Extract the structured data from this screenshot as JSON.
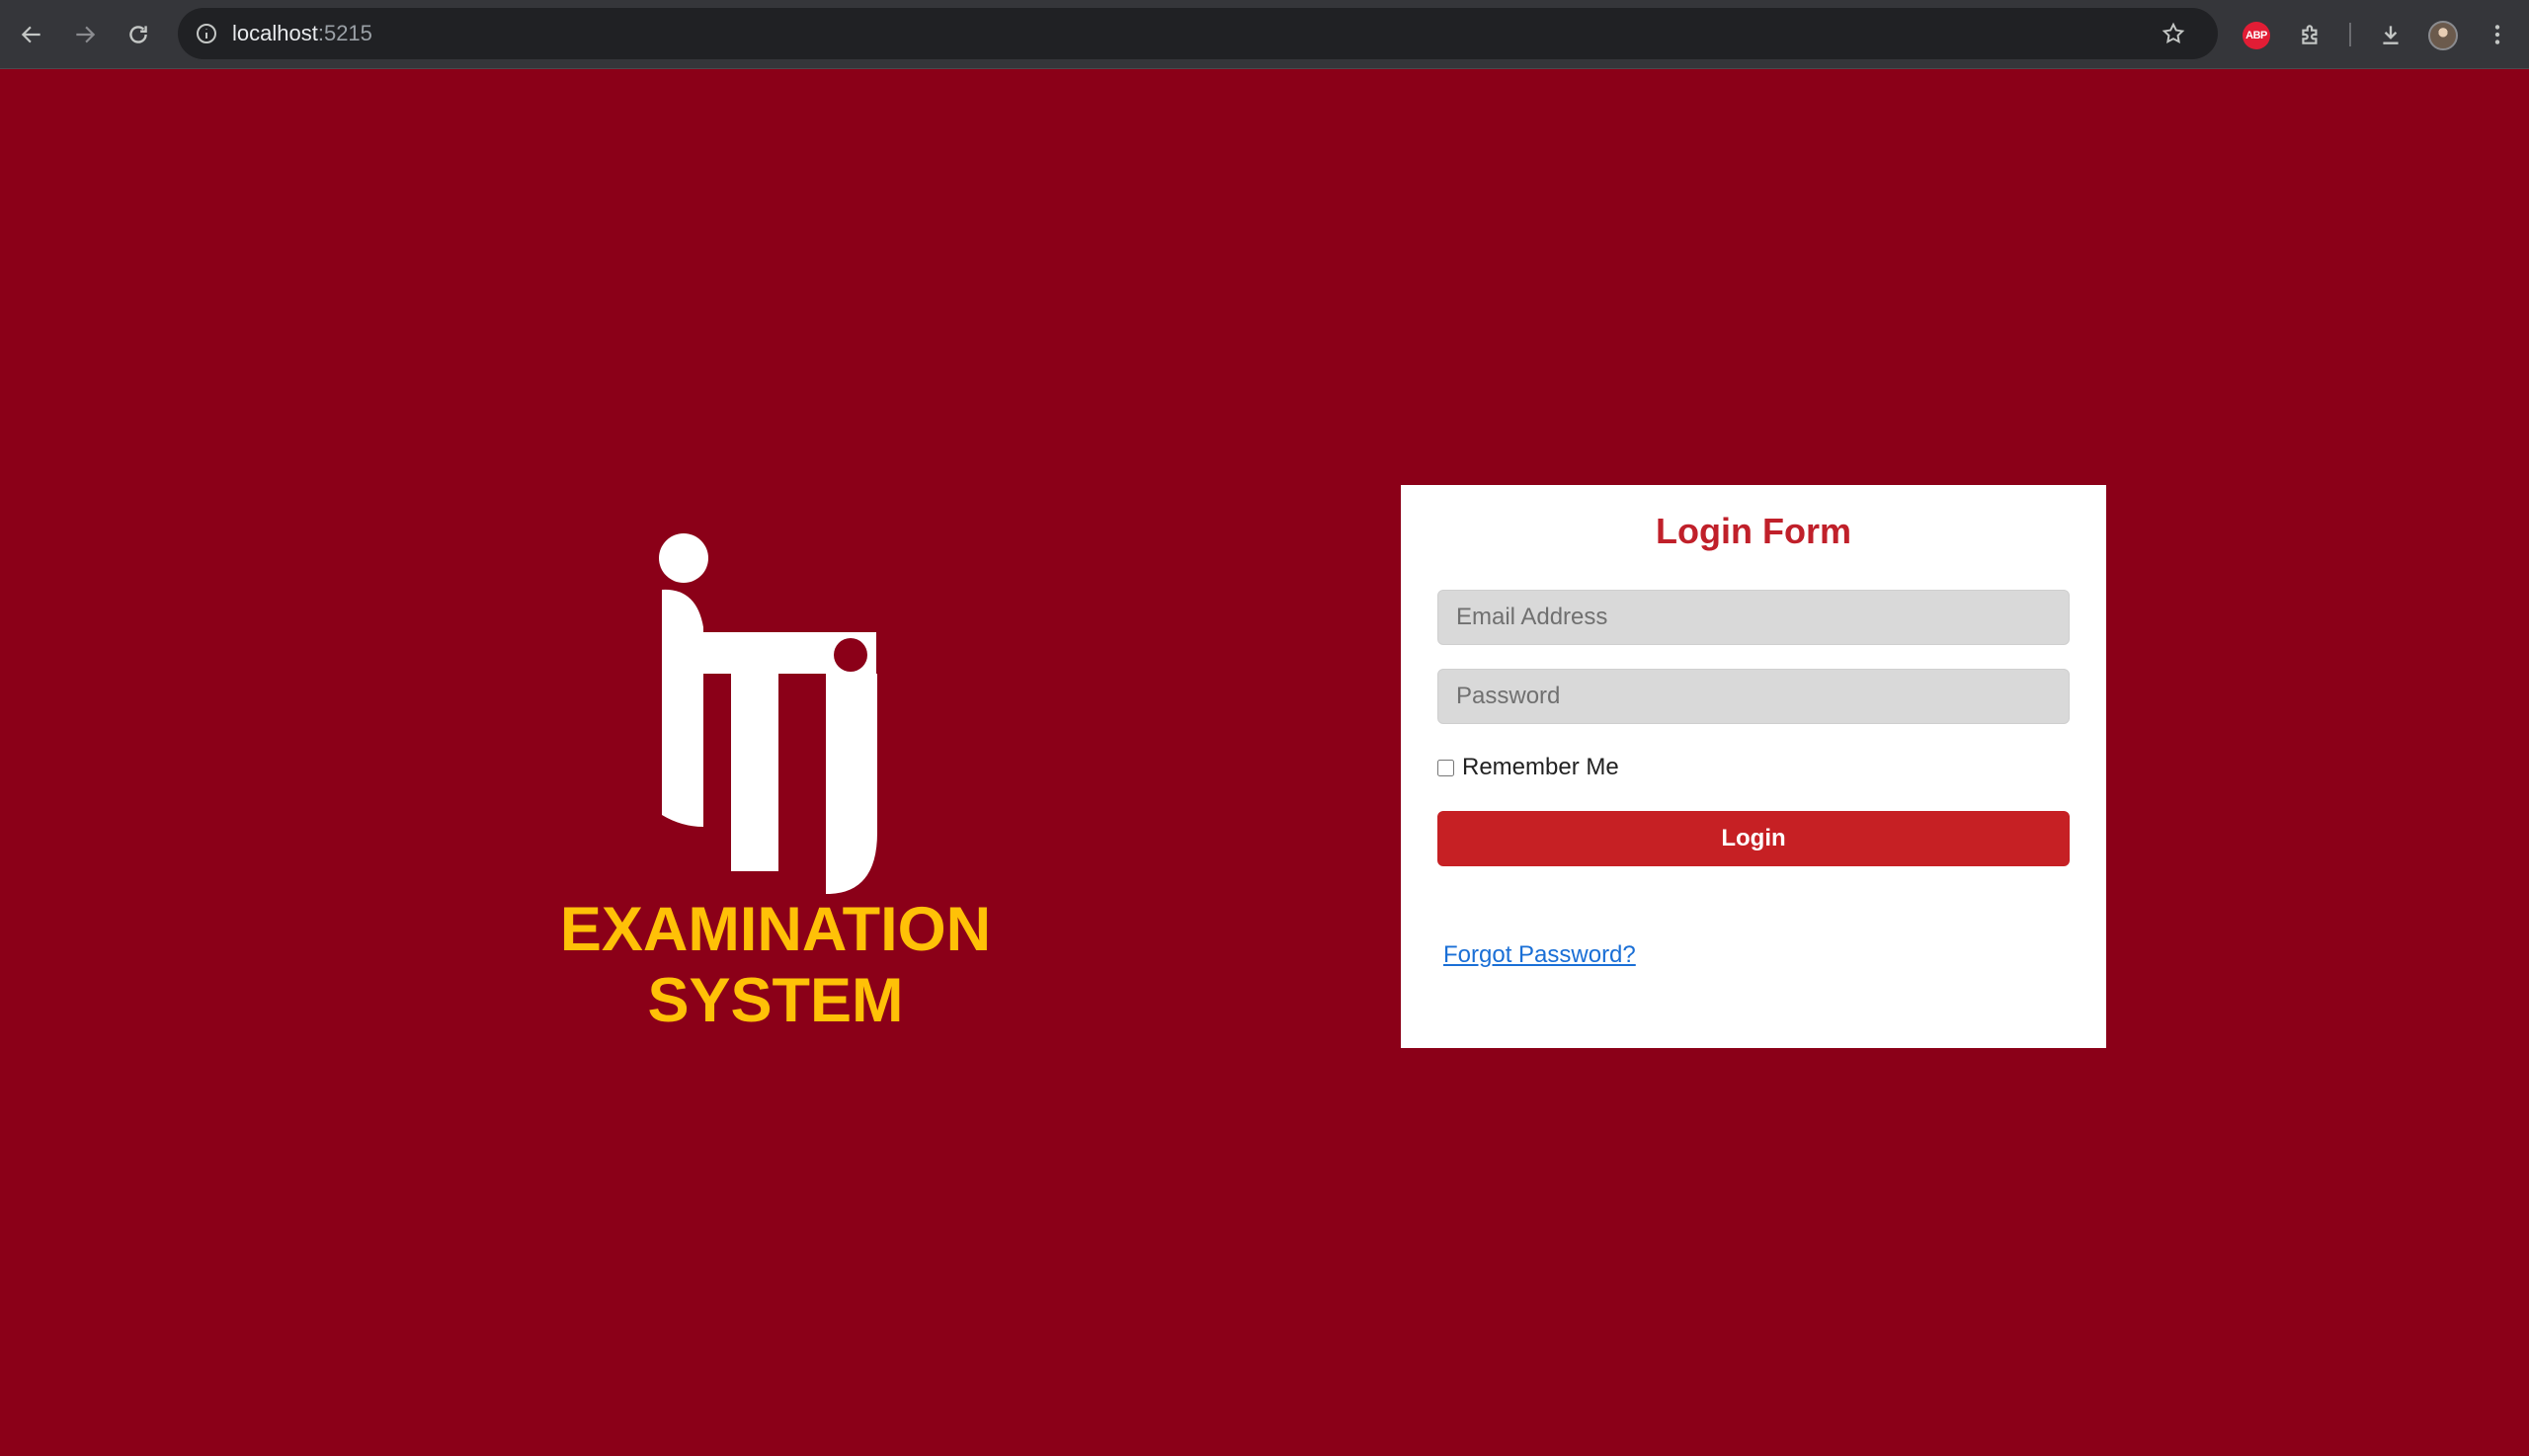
{
  "browser": {
    "url_host": "localhost",
    "url_port": ":5215",
    "extension_badge": "ABP"
  },
  "brand": {
    "logo": "iti-logo",
    "title_line1": "EXAMINATION",
    "title_line2": "SYSTEM",
    "title_color": "#ffc107"
  },
  "login_form": {
    "title": "Login Form",
    "email_placeholder": "Email Address",
    "email_value": "",
    "password_placeholder": "Password",
    "password_value": "",
    "remember_label": "Remember Me",
    "remember_checked": false,
    "login_label": "Login",
    "forgot_label": "Forgot Password?"
  },
  "colors": {
    "page_background": "#8b0018",
    "accent": "#c62024",
    "link": "#1a6fd6"
  }
}
